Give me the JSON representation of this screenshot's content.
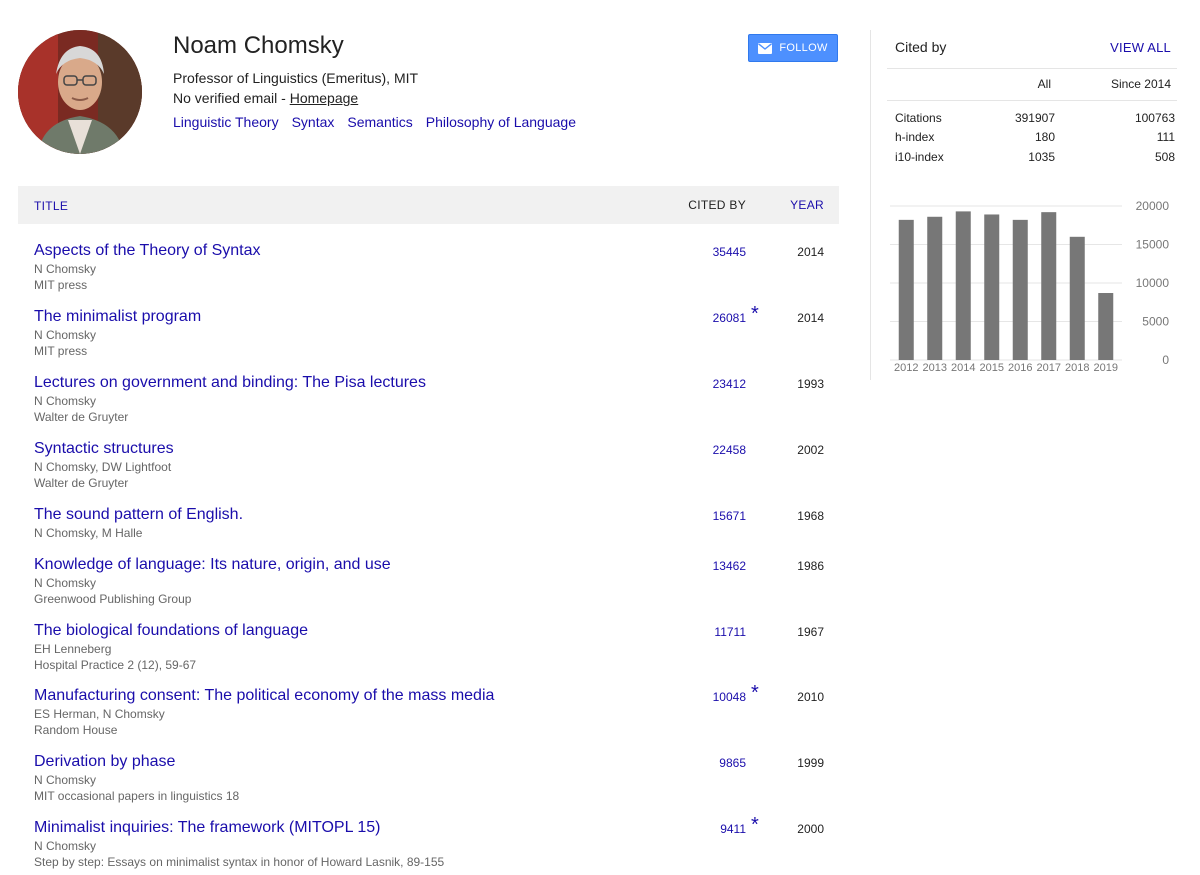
{
  "profile": {
    "name": "Noam Chomsky",
    "affiliation": "Professor of Linguistics (Emeritus), MIT",
    "email_text": "No verified email - ",
    "homepage_label": "Homepage",
    "interests": [
      "Linguistic Theory",
      "Syntax",
      "Semantics",
      "Philosophy of Language"
    ],
    "follow_label": "FOLLOW"
  },
  "table": {
    "col_title": "TITLE",
    "col_cited": "CITED BY",
    "col_year": "YEAR"
  },
  "publications": [
    {
      "title": "Aspects of the Theory of Syntax",
      "authors": "N Chomsky",
      "venue": "MIT press",
      "cited": "35445",
      "star": "",
      "year": "2014"
    },
    {
      "title": "The minimalist program",
      "authors": "N Chomsky",
      "venue": "MIT press",
      "cited": "26081",
      "star": "*",
      "year": "2014"
    },
    {
      "title": "Lectures on government and binding: The Pisa lectures",
      "authors": "N Chomsky",
      "venue": "Walter de Gruyter",
      "cited": "23412",
      "star": "",
      "year": "1993"
    },
    {
      "title": "Syntactic structures",
      "authors": "N Chomsky, DW Lightfoot",
      "venue": "Walter de Gruyter",
      "cited": "22458",
      "star": "",
      "year": "2002"
    },
    {
      "title": "The sound pattern of English.",
      "authors": "N Chomsky, M Halle",
      "venue": "",
      "cited": "15671",
      "star": "",
      "year": "1968"
    },
    {
      "title": "Knowledge of language: Its nature, origin, and use",
      "authors": "N Chomsky",
      "venue": "Greenwood Publishing Group",
      "cited": "13462",
      "star": "",
      "year": "1986"
    },
    {
      "title": "The biological foundations of language",
      "authors": "EH Lenneberg",
      "venue": "Hospital Practice 2 (12), 59-67",
      "cited": "11711",
      "star": "",
      "year": "1967"
    },
    {
      "title": "Manufacturing consent: The political economy of the mass media",
      "authors": "ES Herman, N Chomsky",
      "venue": "Random House",
      "cited": "10048",
      "star": "*",
      "year": "2010"
    },
    {
      "title": "Derivation by phase",
      "authors": "N Chomsky",
      "venue": "MIT occasional papers in linguistics 18",
      "cited": "9865",
      "star": "",
      "year": "1999"
    },
    {
      "title": "Minimalist inquiries: The framework (MITOPL 15)",
      "authors": "N Chomsky",
      "venue": "Step by step: Essays on minimalist syntax in honor of Howard Lasnik, 89-155",
      "cited": "9411",
      "star": "*",
      "year": "2000"
    }
  ],
  "cited_by": {
    "title": "Cited by",
    "view_all": "VIEW ALL",
    "col_all": "All",
    "col_since": "Since 2014",
    "rows": [
      {
        "label": "Citations",
        "all": "391907",
        "since": "100763"
      },
      {
        "label": "h-index",
        "all": "180",
        "since": "111"
      },
      {
        "label": "i10-index",
        "all": "1035",
        "since": "508"
      }
    ]
  },
  "chart_data": {
    "type": "bar",
    "categories": [
      "2012",
      "2013",
      "2014",
      "2015",
      "2016",
      "2017",
      "2018",
      "2019"
    ],
    "values": [
      18200,
      18600,
      19300,
      18900,
      18200,
      19200,
      16000,
      8700
    ],
    "ylim": [
      0,
      20000
    ],
    "yticks": [
      "20000",
      "15000",
      "10000",
      "5000",
      "0"
    ],
    "bar_color": "#777777",
    "grid": true
  },
  "colors": {
    "link": "#1a0dab",
    "follow_button": "#4d90fe",
    "header_bg": "#f1f1f1"
  }
}
